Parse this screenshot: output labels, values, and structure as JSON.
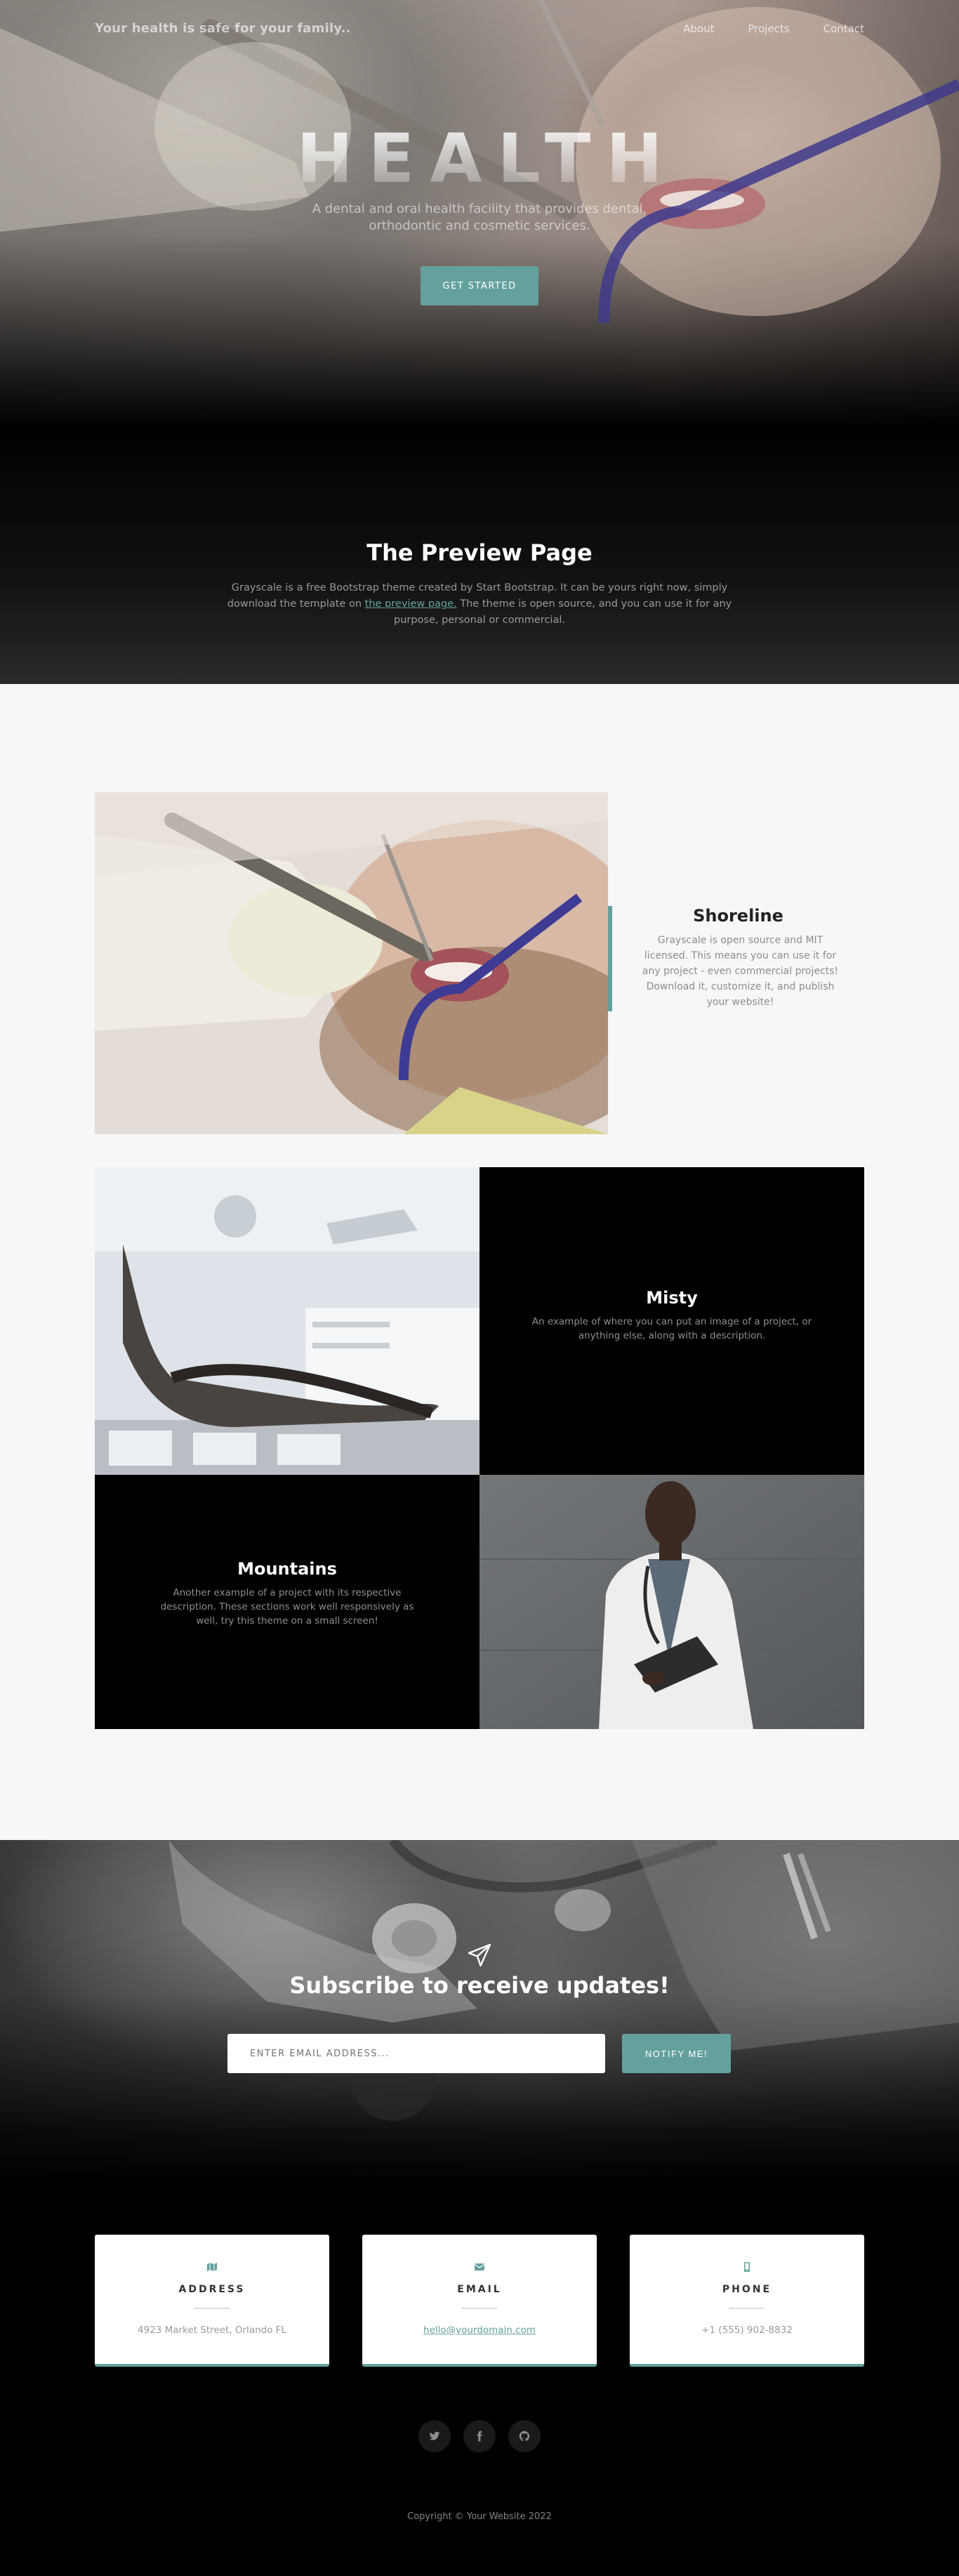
{
  "nav": {
    "brand": "Your health is safe for your family..",
    "links": [
      "About",
      "Projects",
      "Contact"
    ]
  },
  "hero": {
    "title": "HEALTH",
    "subtitle": "A dental and oral health facility that provides dental, orthodontic and cosmetic services.",
    "cta": "GET STARTED"
  },
  "about": {
    "title": "The Preview Page",
    "text_before": "Grayscale is a free Bootstrap theme created by Start Bootstrap. It can be yours right now, simply download the template on ",
    "link": "the preview page.",
    "text_after": " The theme is open source, and you can use it for any purpose, personal or commercial."
  },
  "projects": {
    "featured": {
      "title": "Shoreline",
      "text": "Grayscale is open source and MIT licensed. This means you can use it for any project - even commercial projects! Download it, customize it, and publish your website!"
    },
    "misty": {
      "title": "Misty",
      "text": "An example of where you can put an image of a project, or anything else, along with a description."
    },
    "mountains": {
      "title": "Mountains",
      "text": "Another example of a project with its respective description. These sections work well responsively as well, try this theme on a small screen!"
    }
  },
  "signup": {
    "title": "Subscribe to receive updates!",
    "placeholder": "ENTER EMAIL ADDRESS...",
    "button": "NOTIFY ME!"
  },
  "contact": {
    "address": {
      "title": "ADDRESS",
      "value": "4923 Market Street, Orlando FL",
      "icon": "map-icon"
    },
    "email": {
      "title": "EMAIL",
      "value": "hello@yourdomain.com",
      "icon": "envelope-icon"
    },
    "phone": {
      "title": "PHONE",
      "value": "+1 (555) 902-8832",
      "icon": "mobile-icon"
    }
  },
  "social": [
    "twitter-icon",
    "facebook-icon",
    "github-icon"
  ],
  "footer": {
    "copyright": "Copyright © Your Website 2022"
  },
  "colors": {
    "accent": "#64a19d",
    "dark": "#000000",
    "light_bg": "#f6f7f9"
  }
}
